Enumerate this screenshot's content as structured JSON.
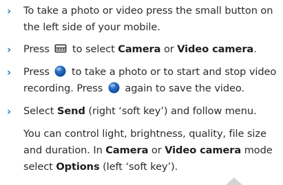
{
  "instructions": [
    {
      "segments": [
        {
          "text": "To take a photo or video press the small button on the left side of your mobile.",
          "bold": false
        }
      ]
    },
    {
      "segments": [
        {
          "text": "Press ",
          "bold": false
        },
        {
          "icon": "keypad-icon"
        },
        {
          "text": " to select ",
          "bold": false
        },
        {
          "text": "Camera",
          "bold": true
        },
        {
          "text": " or ",
          "bold": false
        },
        {
          "text": "Video camera",
          "bold": true
        },
        {
          "text": ".",
          "bold": false
        }
      ]
    },
    {
      "segments": [
        {
          "text": "Press ",
          "bold": false
        },
        {
          "icon": "select-key-icon"
        },
        {
          "text": " to take a photo or to start and stop video recording. Press ",
          "bold": false
        },
        {
          "icon": "select-key-icon"
        },
        {
          "text": " again to save the video.",
          "bold": false
        }
      ]
    },
    {
      "segments": [
        {
          "text": "Select ",
          "bold": false
        },
        {
          "text": "Send",
          "bold": true
        },
        {
          "text": " (right ‘soft key’) and follow menu.",
          "bold": false
        }
      ]
    }
  ],
  "note": {
    "segments": [
      {
        "text": "You can control light, brightness, quality, file size and duration. In ",
        "bold": false
      },
      {
        "text": "Camera",
        "bold": true
      },
      {
        "text": " or ",
        "bold": false
      },
      {
        "text": "Video camera",
        "bold": true
      },
      {
        "text": " mode select ",
        "bold": false
      },
      {
        "text": "Options",
        "bold": true
      },
      {
        "text": " (left ‘soft key’).",
        "bold": false
      }
    ]
  },
  "bullet_mark": "›",
  "colors": {
    "bullet": "#1b7fc4",
    "key_blue": "#1a5fb4",
    "scroll_arrow": "#d3d3d3"
  }
}
